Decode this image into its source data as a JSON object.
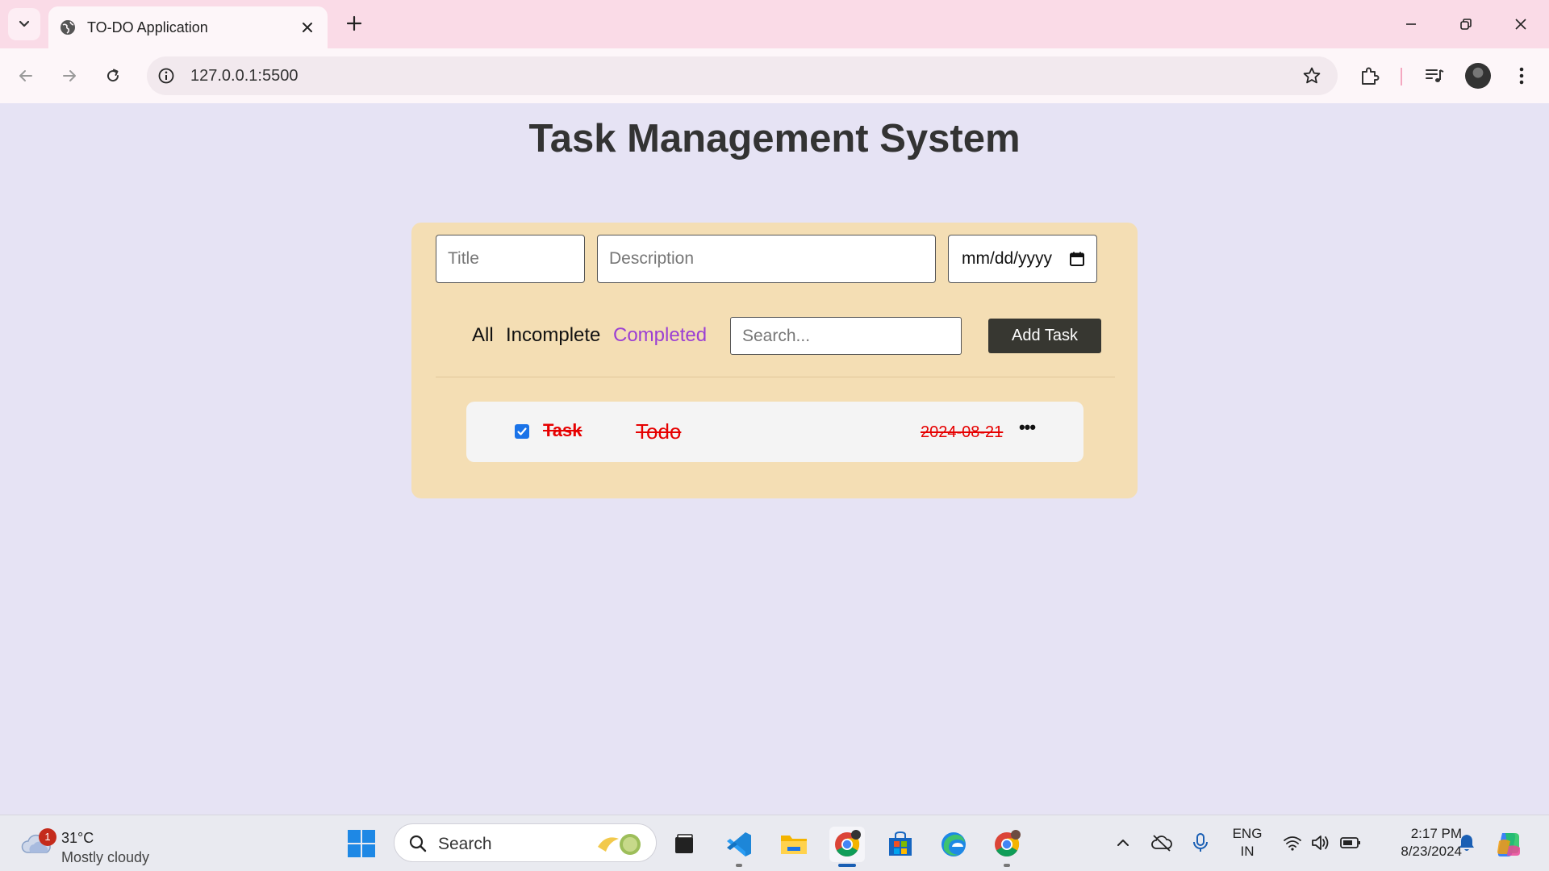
{
  "browser": {
    "tab_title": "TO-DO Application",
    "url": "127.0.0.1:5500"
  },
  "page": {
    "title": "Task Management System",
    "form": {
      "title_placeholder": "Title",
      "description_placeholder": "Description",
      "date_placeholder": "mm/dd/yyyy",
      "search_placeholder": "Search...",
      "add_button": "Add Task"
    },
    "filters": [
      {
        "label": "All",
        "active": false
      },
      {
        "label": "Incomplete",
        "active": false
      },
      {
        "label": "Completed",
        "active": true
      }
    ],
    "tasks": [
      {
        "title": "Task",
        "description": "Todo",
        "date": "2024-08-21",
        "completed": true,
        "menu": "•••"
      }
    ]
  },
  "taskbar": {
    "weather": {
      "badge": "1",
      "temp": "31°C",
      "condition": "Mostly cloudy"
    },
    "search_label": "Search",
    "language": {
      "line1": "ENG",
      "line2": "IN"
    },
    "clock": {
      "time": "2:17 PM",
      "date": "8/23/2024"
    }
  },
  "colors": {
    "page_bg": "#e6e3f4",
    "panel_bg": "#f4deb4",
    "active_filter": "#9b3fd3",
    "completed_text": "#e60000",
    "button_bg": "#373731"
  }
}
